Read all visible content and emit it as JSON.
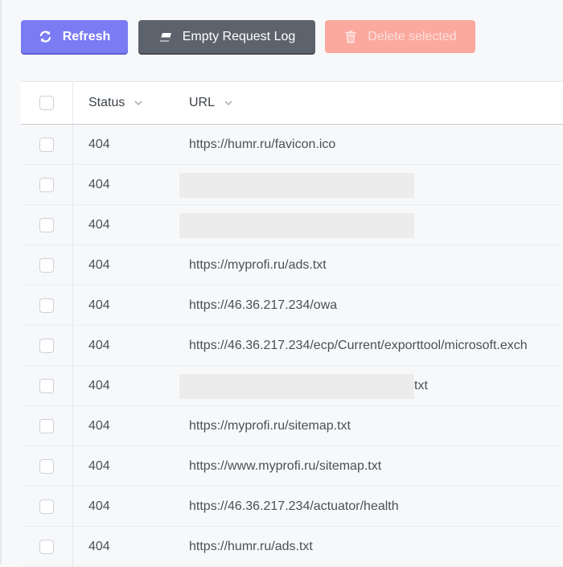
{
  "toolbar": {
    "refresh_label": "Refresh",
    "empty_log_label": "Empty Request Log",
    "delete_label": "Delete selected"
  },
  "table": {
    "columns": [
      "Status",
      "URL"
    ],
    "rows": [
      {
        "status": "404",
        "url": "https://humr.ru/favicon.ico"
      },
      {
        "status": "404",
        "url": ""
      },
      {
        "status": "404",
        "url": ""
      },
      {
        "status": "404",
        "url": "https://myprofi.ru/ads.txt"
      },
      {
        "status": "404",
        "url": "https://46.36.217.234/owa"
      },
      {
        "status": "404",
        "url": "https://46.36.217.234/ecp/Current/exporttool/microsoft.exch"
      },
      {
        "status": "404",
        "url": "txt"
      },
      {
        "status": "404",
        "url": "https://myprofi.ru/sitemap.txt"
      },
      {
        "status": "404",
        "url": "https://www.myprofi.ru/sitemap.txt"
      },
      {
        "status": "404",
        "url": "https://46.36.217.234/actuator/health"
      },
      {
        "status": "404",
        "url": "https://humr.ru/ads.txt"
      }
    ]
  },
  "colors": {
    "refresh": "#7b7bf3",
    "empty_log": "#5d636c",
    "delete_disabled": "#fba99f"
  },
  "icons": {
    "refresh": "refresh-icon",
    "empty_log": "eraser-icon",
    "delete": "trash-icon",
    "sort": "chevron-down-icon"
  }
}
